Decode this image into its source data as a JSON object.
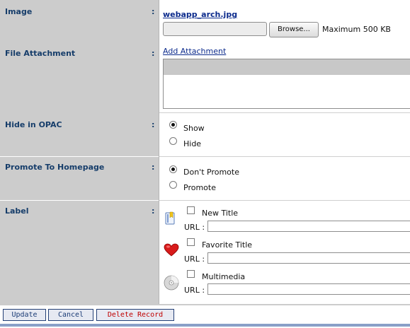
{
  "fields": {
    "image": {
      "label": "Image",
      "colon": ":",
      "filename": "webapp_arch.jpg",
      "browse_label": "Browse...",
      "max_size": "Maximum 500 KB"
    },
    "attachment": {
      "label": "File Attachment",
      "colon": ":",
      "add_link": "Add Attachment"
    },
    "hide_opac": {
      "label": "Hide in OPAC",
      "colon": ":",
      "options": [
        {
          "text": "Show",
          "checked": true
        },
        {
          "text": "Hide",
          "checked": false
        }
      ]
    },
    "promote": {
      "label": "Promote To Homepage",
      "colon": ":",
      "options": [
        {
          "text": "Don't Promote",
          "checked": true
        },
        {
          "text": "Promote",
          "checked": false
        }
      ]
    },
    "label": {
      "label": "Label",
      "colon": ":",
      "items": [
        {
          "title": "New Title",
          "icon": "new-title-icon",
          "url_label": "URL :",
          "url_value": ""
        },
        {
          "title": "Favorite Title",
          "icon": "heart-icon",
          "url_label": "URL :",
          "url_value": ""
        },
        {
          "title": "Multimedia",
          "icon": "cd-disc-icon",
          "url_label": "URL :",
          "url_value": ""
        }
      ]
    }
  },
  "actions": {
    "update": "Update",
    "cancel": "Cancel",
    "delete": "Delete Record"
  },
  "colors": {
    "label_bg": "#cccccc",
    "label_text": "#163d6a",
    "link": "#0b2a8c",
    "danger": "#c00000",
    "button_border": "#233f76"
  }
}
